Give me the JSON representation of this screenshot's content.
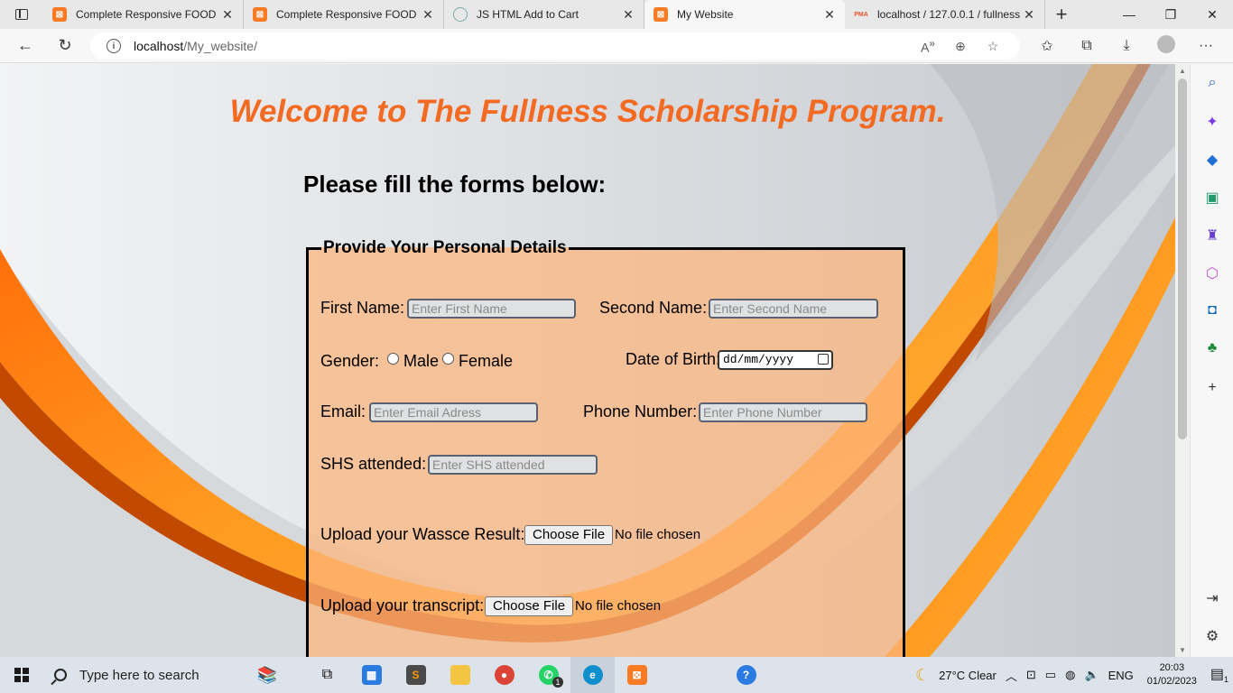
{
  "browser": {
    "tabs": [
      {
        "title": "Complete Responsive FOOD W",
        "favicon": "xampp-icon",
        "active": false
      },
      {
        "title": "Complete Responsive FOOD W",
        "favicon": "xampp-icon",
        "active": false
      },
      {
        "title": "JS HTML Add to Cart",
        "favicon": "codepen-icon",
        "active": false
      },
      {
        "title": "My Website",
        "favicon": "xampp-icon",
        "active": true
      },
      {
        "title": "localhost / 127.0.0.1 / fullness",
        "favicon": "phpmyadmin-icon",
        "active": false
      }
    ],
    "url_host": "localhost",
    "url_path": "/My_website/"
  },
  "page": {
    "heading": "Welcome to The Fullness Scholarship Program.",
    "subheading": "Please fill the forms below:",
    "fieldset_legend": "Provide Your Personal Details",
    "first_name_label": "First Name:",
    "first_name_placeholder": "Enter First Name",
    "second_name_label": "Second Name:",
    "second_name_placeholder": "Enter Second Name",
    "gender_label": "Gender:",
    "gender_options": [
      "Male",
      "Female"
    ],
    "dob_label": "Date of Birth:",
    "dob_value": "dd/mm/yyyy",
    "email_label": "Email:",
    "email_placeholder": "Enter Email Adress",
    "phone_label": "Phone Number:",
    "phone_placeholder": "Enter Phone Number",
    "shs_label": "SHS attended:",
    "shs_placeholder": "Enter SHS attended",
    "wassce_label": "Upload your Wassce Result:",
    "transcript_label": "Upload your transcript:",
    "file_button": "Choose File",
    "file_status": "No file chosen"
  },
  "taskbar": {
    "search_placeholder": "Type here to search",
    "weather": "27°C  Clear",
    "language": "ENG",
    "time": "20:03",
    "date": "01/02/2023",
    "whatsapp_badge": "1",
    "notification_badge": "1"
  },
  "colors": {
    "heading": "#f36a23",
    "form_background": "#fcb47c"
  }
}
